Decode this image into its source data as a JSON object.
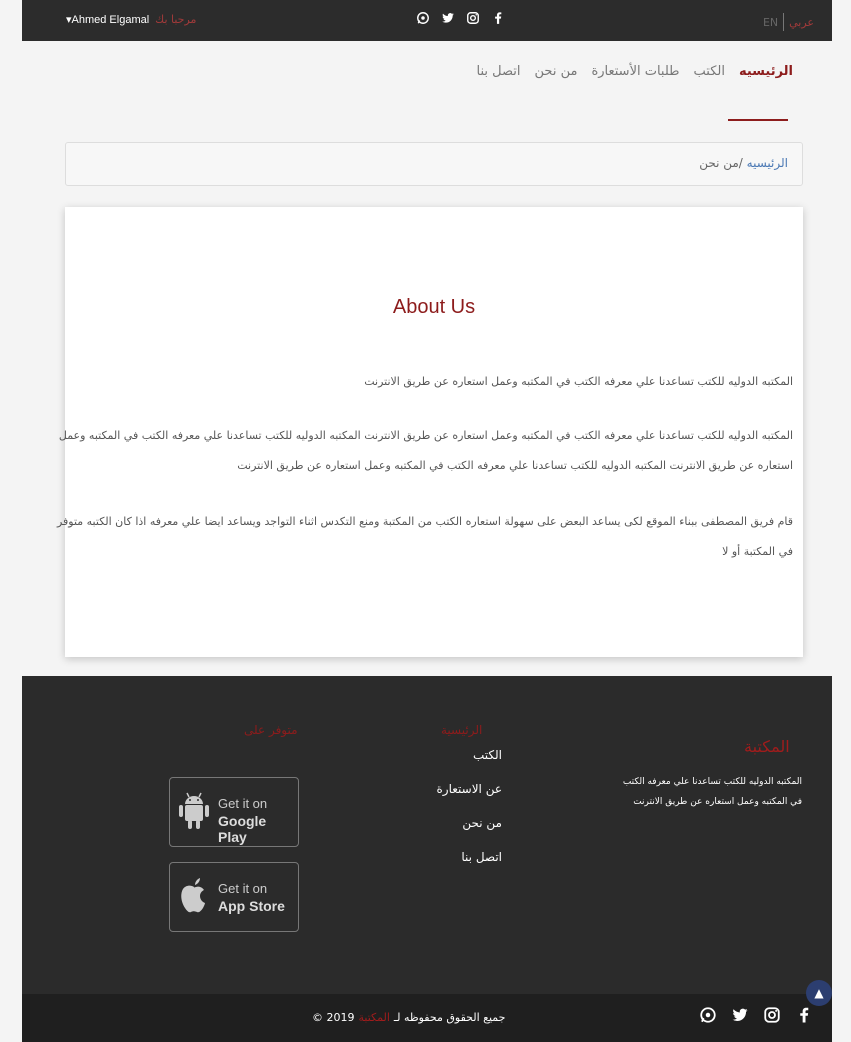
{
  "topbar": {
    "greeting": "مرحبا بك",
    "username": "▾Ahmed Elgamal",
    "lang_en": "EN",
    "lang_ar": "عربي",
    "social_icons": [
      "whatsapp-icon",
      "twitter-icon",
      "instagram-icon",
      "facebook-icon"
    ]
  },
  "nav": {
    "items": [
      {
        "label": "الرئيسيه",
        "active": true
      },
      {
        "label": "الكتب",
        "active": false
      },
      {
        "label": "طلبات الأستعارة",
        "active": false
      },
      {
        "label": "من نحن",
        "active": false
      },
      {
        "label": "اتصل بنا",
        "active": false
      }
    ]
  },
  "breadcrumb": {
    "home": "الرئيسيه",
    "current": " /من نحن"
  },
  "about": {
    "title": "About Us",
    "paragraph1": "المكتبه الدوليه للكتب تساعدنا علي معرفه الكتب في المكتبه وعمل استعاره عن طريق الانترنت",
    "paragraph2": "المكتبه الدوليه للكتب تساعدنا علي معرفه الكتب في المكتبه وعمل استعاره عن طريق الانترنت المكتبه الدوليه للكتب تساعدنا علي معرفه الكتب في المكتبه وعمل استعاره عن طريق الانترنت المكتبه الدوليه للكتب تساعدنا علي معرفه الكتب في المكتبه وعمل استعاره عن طريق الانترنت",
    "paragraph3": "قام فريق المصطفى ببناء الموقع لكى يساعد البعض على سهولة استعاره الكتب من المكتبة ومنع التكدس اثناء التواجد ويساعد ايضا علي معرفه اذا كان الكتبه متوفر في المكتبة أو لا"
  },
  "footer": {
    "brand_title": "المكتبة",
    "brand_desc": "المكتبه الدوليه للكتب تساعدنا علي معرفه الكتب في المكتبه وعمل استعاره عن طريق الانترنت",
    "links_title": "الرئيسية",
    "links": [
      "الكتب",
      "عن الاستعارة",
      "من نحن",
      "اتصل بنا"
    ],
    "avail_title": "متوفر على",
    "google_play": {
      "line1": "Get it on",
      "line2": "Google Play"
    },
    "app_store": {
      "line1": "Get it on",
      "line2": "App Store"
    }
  },
  "copyright": {
    "prefix": "جميع الحقوق محفوظه لـ",
    "library": "المكتبة",
    "suffix": "© 2019"
  },
  "colors": {
    "accent": "#8d1c1c",
    "dark": "#2b2b2b",
    "link": "#4a78b4"
  }
}
